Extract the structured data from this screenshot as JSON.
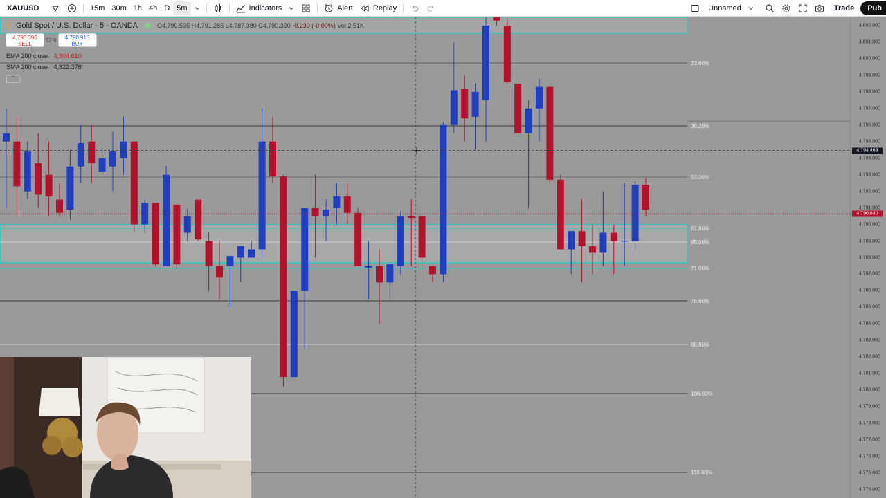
{
  "toolbar": {
    "symbol": "XAUUSD",
    "intervals": [
      "15m",
      "30m",
      "1h",
      "4h",
      "D",
      "5m"
    ],
    "active_interval": "5m",
    "indicators_label": "Indicators",
    "alert_label": "Alert",
    "replay_label": "Replay",
    "layout_name": "Unnamed",
    "trade_label": "Trade",
    "publish_label": "Pub"
  },
  "legend": {
    "title": "Gold Spot / U.S. Dollar · 5 · OANDA",
    "open": "O4,790.595",
    "high": "H4,791.265",
    "low": "L4,787.380",
    "close": "C4,790.360",
    "change": "-0.230 (-0.00%)",
    "volume": "Vol 2.51K",
    "sell_price": "4,790.396",
    "sell_label": "SELL",
    "spread": "52.0",
    "buy_price": "4,790.910",
    "buy_label": "BUY",
    "ema_label": "EMA 200 close",
    "ema_value": "4,804.610",
    "sma_label": "SMA 200 close",
    "sma_value": "4,822.378"
  },
  "price_axis": {
    "ticks": [
      "4,802.000",
      "4,801.000",
      "4,800.000",
      "4,799.000",
      "4,798.000",
      "4,797.000",
      "4,796.000",
      "4,795.000",
      "4,794.000",
      "4,793.000",
      "4,792.000",
      "4,791.000",
      "4,790.000",
      "4,789.000",
      "4,788.000",
      "4,787.000",
      "4,786.000",
      "4,785.000",
      "4,784.000",
      "4,783.000",
      "4,782.000",
      "4,781.000",
      "4,780.000",
      "4,779.000",
      "4,778.000",
      "4,777.000",
      "4,776.000",
      "4,775.000",
      "4,774.000"
    ],
    "crosshair_price": "4,794.463",
    "last_price": "4,790.640"
  },
  "fib_levels": [
    "23.60%",
    "38.20%",
    "50.00%",
    "61.80%",
    "65.00%",
    "71.00%",
    "78.60%",
    "88.60%",
    "100.00%",
    "118.00%"
  ],
  "colors": {
    "up_candle": "#1f3fbf",
    "down_candle": "#b3122c",
    "zone_border": "#2ec4c4",
    "background": "#9a9a9a"
  },
  "chart_data": {
    "type": "candlestick",
    "title": "Gold Spot / U.S. Dollar · 5 · OANDA",
    "ylim": [
      4773.5,
      4802.5
    ],
    "candles": [
      {
        "o": 4795.0,
        "h": 4797.0,
        "l": 4791.0,
        "c": 4795.5
      },
      {
        "o": 4795.0,
        "h": 4796.5,
        "l": 4790.5,
        "c": 4792.3
      },
      {
        "o": 4792.0,
        "h": 4795.0,
        "l": 4791.5,
        "c": 4794.4
      },
      {
        "o": 4793.7,
        "h": 4795.5,
        "l": 4791.0,
        "c": 4791.8
      },
      {
        "o": 4793.0,
        "h": 4795.0,
        "l": 4790.5,
        "c": 4791.7
      },
      {
        "o": 4791.5,
        "h": 4792.5,
        "l": 4790.5,
        "c": 4790.7
      },
      {
        "o": 4790.9,
        "h": 4794.5,
        "l": 4790.3,
        "c": 4793.5
      },
      {
        "o": 4793.5,
        "h": 4796.0,
        "l": 4792.5,
        "c": 4794.9
      },
      {
        "o": 4795.0,
        "h": 4796.0,
        "l": 4792.5,
        "c": 4793.7
      },
      {
        "o": 4793.2,
        "h": 4794.6,
        "l": 4793.0,
        "c": 4794.0
      },
      {
        "o": 4793.5,
        "h": 4795.6,
        "l": 4792.0,
        "c": 4794.4
      },
      {
        "o": 4794.0,
        "h": 4796.5,
        "l": 4793.0,
        "c": 4795.0
      },
      {
        "o": 4795.0,
        "h": 4795.0,
        "l": 4789.5,
        "c": 4790.0
      },
      {
        "o": 4790.0,
        "h": 4791.5,
        "l": 4789.5,
        "c": 4791.3
      },
      {
        "o": 4791.3,
        "h": 4791.3,
        "l": 4787.5,
        "c": 4787.6
      },
      {
        "o": 4787.5,
        "h": 4793.5,
        "l": 4787.5,
        "c": 4793.0
      },
      {
        "o": 4791.2,
        "h": 4791.2,
        "l": 4787.3,
        "c": 4787.6
      },
      {
        "o": 4789.5,
        "h": 4791.0,
        "l": 4789.0,
        "c": 4790.5
      },
      {
        "o": 4791.5,
        "h": 4791.5,
        "l": 4789.0,
        "c": 4789.1
      },
      {
        "o": 4789.0,
        "h": 4789.5,
        "l": 4786.0,
        "c": 4787.5
      },
      {
        "o": 4787.5,
        "h": 4789.0,
        "l": 4785.5,
        "c": 4786.8
      },
      {
        "o": 4787.5,
        "h": 4788.0,
        "l": 4785.0,
        "c": 4788.1
      },
      {
        "o": 4788.0,
        "h": 4788.7,
        "l": 4786.5,
        "c": 4788.7
      },
      {
        "o": 4788.0,
        "h": 4789.0,
        "l": 4788.0,
        "c": 4788.5
      },
      {
        "o": 4788.5,
        "h": 4797.0,
        "l": 4788.0,
        "c": 4795.0
      },
      {
        "o": 4795.0,
        "h": 4796.5,
        "l": 4792.5,
        "c": 4792.9
      },
      {
        "o": 4792.9,
        "h": 4793.0,
        "l": 4780.2,
        "c": 4780.8
      },
      {
        "o": 4780.8,
        "h": 4786.0,
        "l": 4780.8,
        "c": 4786.0
      },
      {
        "o": 4786.0,
        "h": 4791.0,
        "l": 4782.5,
        "c": 4791.0
      },
      {
        "o": 4791.0,
        "h": 4793.0,
        "l": 4788.0,
        "c": 4790.5
      },
      {
        "o": 4790.5,
        "h": 4791.5,
        "l": 4789.0,
        "c": 4790.9
      },
      {
        "o": 4791.0,
        "h": 4792.5,
        "l": 4790.0,
        "c": 4791.7
      },
      {
        "o": 4791.7,
        "h": 4792.5,
        "l": 4790.0,
        "c": 4790.7
      },
      {
        "o": 4790.7,
        "h": 4791.0,
        "l": 4787.5,
        "c": 4787.5
      },
      {
        "o": 4787.4,
        "h": 4789.0,
        "l": 4785.5,
        "c": 4787.5
      },
      {
        "o": 4787.5,
        "h": 4788.5,
        "l": 4784.0,
        "c": 4786.5
      },
      {
        "o": 4786.5,
        "h": 4787.6,
        "l": 4785.5,
        "c": 4787.6
      },
      {
        "o": 4787.5,
        "h": 4790.8,
        "l": 4787.0,
        "c": 4790.5
      },
      {
        "o": 4790.5,
        "h": 4791.5,
        "l": 4787.5,
        "c": 4790.4
      },
      {
        "o": 4790.5,
        "h": 4790.5,
        "l": 4786.5,
        "c": 4788.0
      },
      {
        "o": 4787.5,
        "h": 4787.5,
        "l": 4786.5,
        "c": 4787.0
      },
      {
        "o": 4787.0,
        "h": 4796.2,
        "l": 4786.5,
        "c": 4796.0
      },
      {
        "o": 4796.0,
        "h": 4801.0,
        "l": 4795.5,
        "c": 4798.1
      },
      {
        "o": 4798.2,
        "h": 4799.0,
        "l": 4795.0,
        "c": 4796.4
      },
      {
        "o": 4796.5,
        "h": 4798.5,
        "l": 4794.5,
        "c": 4798.0
      },
      {
        "o": 4797.5,
        "h": 4802.5,
        "l": 4795.0,
        "c": 4802.0
      },
      {
        "o": 4802.5,
        "h": 4802.8,
        "l": 4802.0,
        "c": 4802.3
      },
      {
        "o": 4802.0,
        "h": 4802.5,
        "l": 4798.5,
        "c": 4798.6
      },
      {
        "o": 4798.5,
        "h": 4798.5,
        "l": 4795.5,
        "c": 4795.5
      },
      {
        "o": 4795.5,
        "h": 4797.5,
        "l": 4791.0,
        "c": 4797.0
      },
      {
        "o": 4797.0,
        "h": 4798.8,
        "l": 4795.0,
        "c": 4798.3
      },
      {
        "o": 4798.3,
        "h": 4798.3,
        "l": 4792.5,
        "c": 4792.7
      },
      {
        "o": 4792.7,
        "h": 4793.0,
        "l": 4788.5,
        "c": 4788.5
      },
      {
        "o": 4788.5,
        "h": 4789.5,
        "l": 4787.0,
        "c": 4789.6
      },
      {
        "o": 4789.6,
        "h": 4791.5,
        "l": 4786.5,
        "c": 4788.7
      },
      {
        "o": 4788.7,
        "h": 4790.0,
        "l": 4787.0,
        "c": 4788.3
      },
      {
        "o": 4788.3,
        "h": 4792.0,
        "l": 4787.5,
        "c": 4789.5
      },
      {
        "o": 4789.5,
        "h": 4790.0,
        "l": 4787.0,
        "c": 4789.0
      },
      {
        "o": 4789.0,
        "h": 4792.5,
        "l": 4787.5,
        "c": 4789.0
      },
      {
        "o": 4789.0,
        "h": 4792.6,
        "l": 4788.5,
        "c": 4792.4
      },
      {
        "o": 4792.4,
        "h": 4792.8,
        "l": 4790.5,
        "c": 4790.9
      }
    ]
  }
}
